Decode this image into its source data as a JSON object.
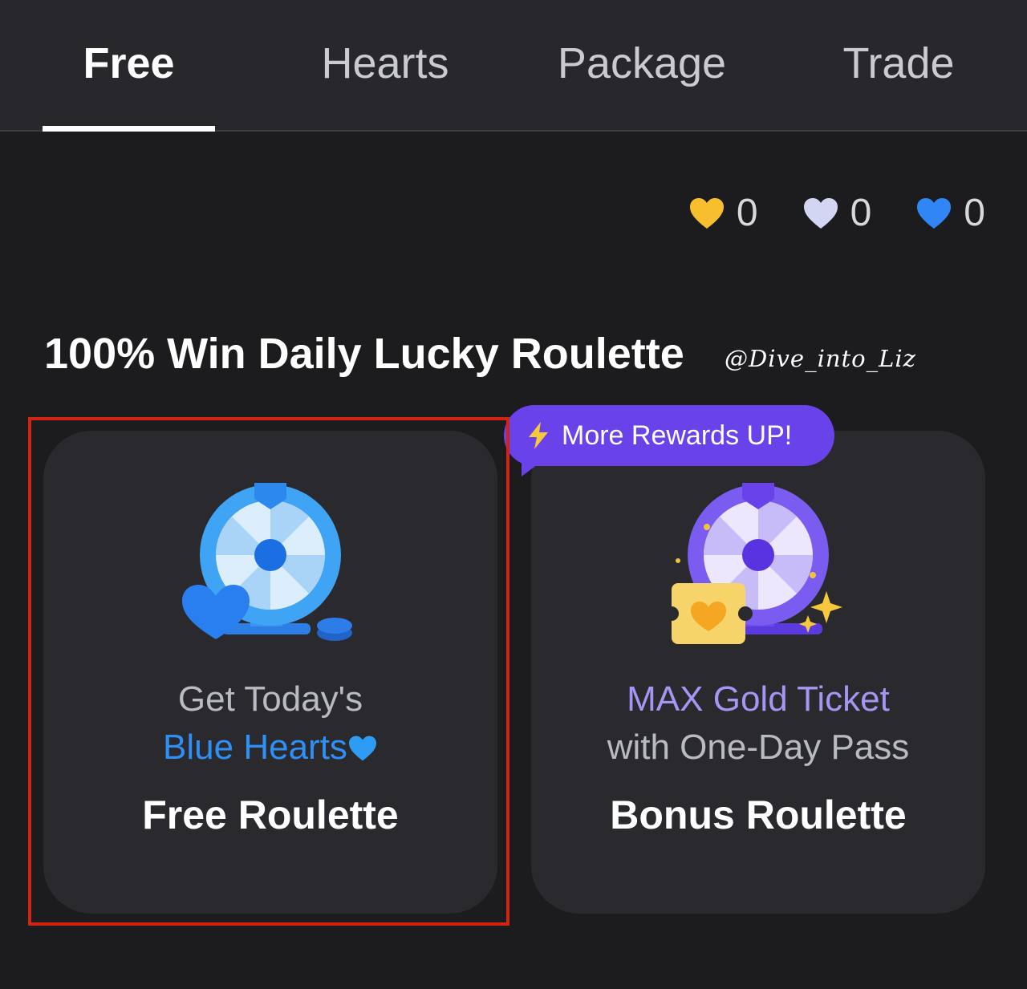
{
  "tabs": [
    {
      "label": "Free",
      "active": true
    },
    {
      "label": "Hearts",
      "active": false
    },
    {
      "label": "Package",
      "active": false
    },
    {
      "label": "Trade",
      "active": false
    }
  ],
  "counters": [
    {
      "icon": "gold-heart-icon",
      "color": "#f7be2e",
      "value": "0"
    },
    {
      "icon": "white-heart-icon",
      "color": "#d3d6f2",
      "value": "0"
    },
    {
      "icon": "blue-heart-icon",
      "color": "#2f86f4",
      "value": "0"
    }
  ],
  "section": {
    "title": "100% Win Daily Lucky Roulette",
    "watermark": "@Dive_into_Liz"
  },
  "promo": {
    "icon": "lightning-icon",
    "label": "More Rewards UP!"
  },
  "cards": {
    "free": {
      "line1": "Get Today's",
      "line2_highlight": "Blue Hearts",
      "line2_icon": "blue-heart-icon",
      "title": "Free Roulette"
    },
    "bonus": {
      "line1_highlight": "MAX Gold Ticket",
      "line2": "with One-Day Pass",
      "title": "Bonus Roulette"
    }
  },
  "colors": {
    "background": "#1c1c1e",
    "tabbar": "#28282c",
    "card": "#2a2a2e",
    "blue_accent": "#2e8ff5",
    "purple_accent": "#a695f2",
    "promo_badge": "#6a42ea",
    "highlight_border": "#d52312"
  }
}
